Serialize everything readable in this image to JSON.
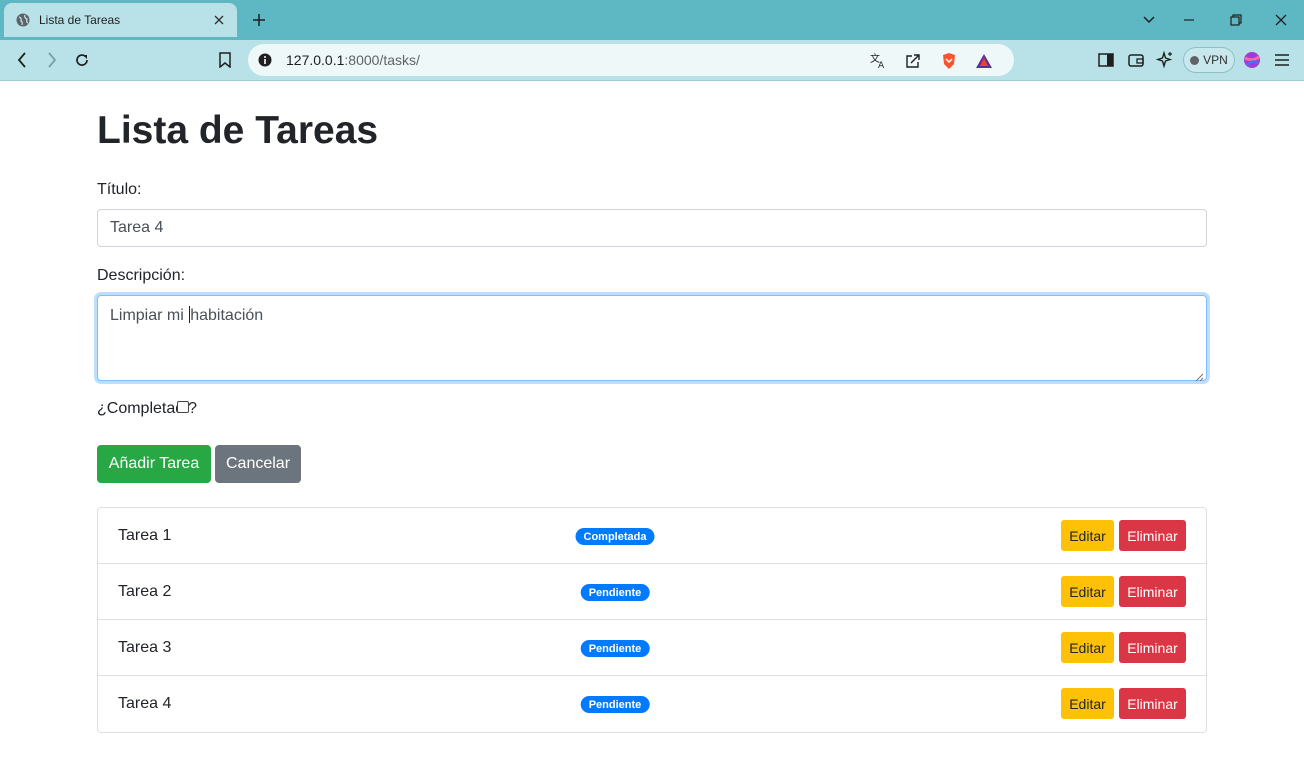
{
  "browser": {
    "tab_title": "Lista de Tareas",
    "url_host": "127.0.0.1",
    "url_path": ":8000/tasks/",
    "vpn_label": "VPN"
  },
  "page": {
    "heading": "Lista de Tareas",
    "title_label": "Título:",
    "title_value": "Tarea 4",
    "description_label": "Descripción:",
    "description_before_caret": "Limpiar mi ",
    "description_after_caret": "habitación",
    "completed_label_start": "¿Completad",
    "completed_label_end": "?",
    "add_button": "Añadir Tarea",
    "cancel_button": "Cancelar"
  },
  "tasks": [
    {
      "name": "Tarea 1",
      "status": "Completada",
      "edit": "Editar",
      "delete": "Eliminar"
    },
    {
      "name": "Tarea 2",
      "status": "Pendiente",
      "edit": "Editar",
      "delete": "Eliminar"
    },
    {
      "name": "Tarea 3",
      "status": "Pendiente",
      "edit": "Editar",
      "delete": "Eliminar"
    },
    {
      "name": "Tarea 4",
      "status": "Pendiente",
      "edit": "Editar",
      "delete": "Eliminar"
    }
  ],
  "colors": {
    "chrome_tabbar": "#5eb8c4",
    "chrome_toolbar": "#b9e2e8",
    "success": "#28a745",
    "secondary": "#6c757d",
    "primary": "#007bff",
    "warning": "#ffc107",
    "danger": "#dc3545"
  }
}
